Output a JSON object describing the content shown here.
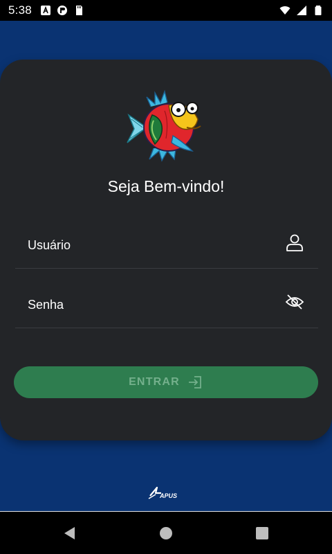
{
  "status_bar": {
    "time": "5:38",
    "left_icons": [
      "text-notification-icon",
      "app-notification-icon",
      "sd-card-icon"
    ],
    "right_icons": [
      "wifi-icon",
      "signal-icon",
      "battery-icon"
    ]
  },
  "login": {
    "welcome_text": "Seja Bem-vindo!",
    "username_label": "Usuário",
    "password_label": "Senha",
    "submit_label": "ENTRAR"
  },
  "footer": {
    "brand": "APUS"
  },
  "colors": {
    "background": "#0a3372",
    "card": "#232528",
    "button": "#2e7d4f",
    "button_text": "#74b08c"
  },
  "icons": {
    "username_field": "person-icon",
    "password_field": "eye-off-icon",
    "submit": "login-arrow-icon"
  }
}
